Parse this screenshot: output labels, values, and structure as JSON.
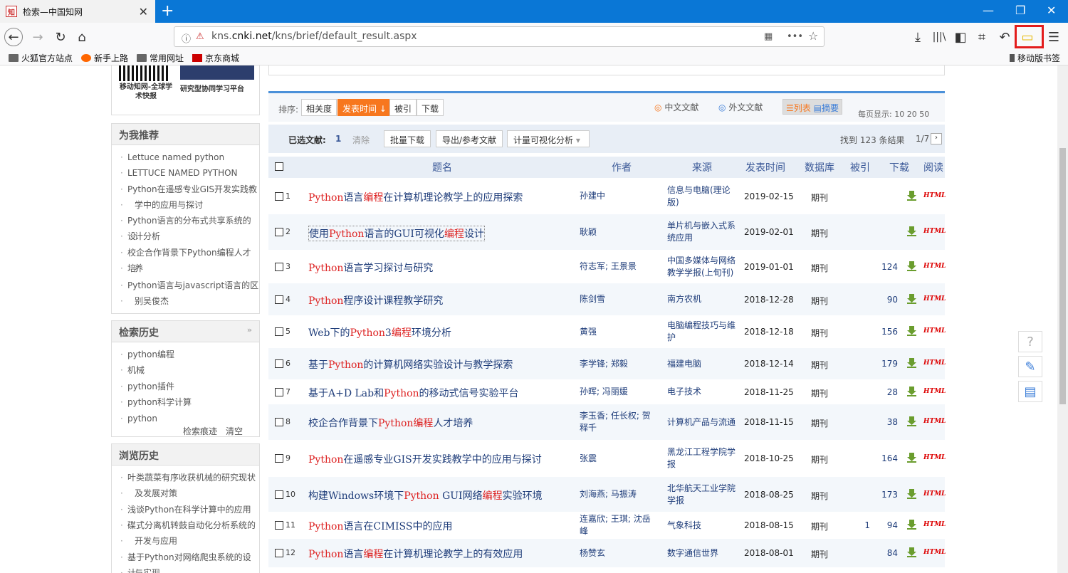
{
  "browser": {
    "tab_title": "检索—中国知网",
    "favicon_label": "知",
    "url_prefix": "kns.",
    "url_domain": "cnki.net",
    "url_path": "/kns/brief/default_result.aspx",
    "bookmarks": [
      "火狐官方站点",
      "新手上路",
      "常用网址",
      "京东商城"
    ],
    "mobile_bookmarks": "移动版书签"
  },
  "sidebar": {
    "qr_label": "移动知网-全球学术快报",
    "banner_label": "研究型协同学习平台",
    "recommend_title": "为我推荐",
    "recommend": [
      "Lettuce named python",
      "LETTUCE NAMED PYTHON",
      "Python在遥感专业GIS开发实践教",
      "学中的应用与探讨",
      "Python语言的分布式共享系统的设",
      "计分析",
      "校企合作背景下Python编程人才培",
      "养",
      "Python语言与javascript语言的区",
      "别吴俊杰"
    ],
    "history_title": "检索历史",
    "history": [
      "python编程",
      "机械",
      "python插件",
      "python科学计算",
      "python"
    ],
    "history_trace": "检索痕迹",
    "history_clear": "清空",
    "browse_title": "浏览历史",
    "browse": [
      "叶类蔬菜有序收获机械的研究现状",
      "及发展对策",
      "浅谈Python在科学计算中的应用",
      "碟式分离机转鼓自动化分析系统的",
      "开发与应用",
      "基于Python对网络爬虫系统的设计",
      "与实现"
    ]
  },
  "toolbar": {
    "sort_label": "排序:",
    "sort_options": [
      "相关度",
      "发表时间",
      "被引",
      "下载"
    ],
    "chinese_docs": "中文文献",
    "foreign_docs": "外文文献",
    "view_list": "列表",
    "view_abstract": "摘要",
    "per_page": "每页显示: 10 20 50",
    "selected_label": "已选文献:",
    "selected_count": "1",
    "clear": "清除",
    "batch_download": "批量下载",
    "export": "导出/参考文献",
    "visualize": "计量可视化分析",
    "result_count": "找到 123 条结果",
    "page_info": "1/7"
  },
  "table": {
    "headers": [
      "题名",
      "作者",
      "来源",
      "发表时间",
      "数据库",
      "被引",
      "下载",
      "阅读"
    ],
    "rows": [
      {
        "n": "1",
        "title": "Python语言编程在计算机理论教学上的应用探索",
        "author": "孙建中",
        "source": "信息与电脑(理论版)",
        "date": "2019-02-15",
        "db": "期刊",
        "cite": "",
        "dl": ""
      },
      {
        "n": "2",
        "title": "使用Python语言的GUI可视化编程设计",
        "author": "耿颖",
        "source": "单片机与嵌入式系统应用",
        "date": "2019-02-01",
        "db": "期刊",
        "cite": "",
        "dl": ""
      },
      {
        "n": "3",
        "title": "Python语言学习探讨与研究",
        "author": "符志军; 王景景",
        "source": "中国多媒体与网络教学学报(上旬刊)",
        "date": "2019-01-01",
        "db": "期刊",
        "cite": "",
        "dl": "124"
      },
      {
        "n": "4",
        "title": "Python程序设计课程教学研究",
        "author": "陈剑雪",
        "source": "南方农机",
        "date": "2018-12-28",
        "db": "期刊",
        "cite": "",
        "dl": "90"
      },
      {
        "n": "5",
        "title": "Web下的Python3编程环境分析",
        "author": "黄强",
        "source": "电脑编程技巧与维护",
        "date": "2018-12-18",
        "db": "期刊",
        "cite": "",
        "dl": "156"
      },
      {
        "n": "6",
        "title": "基于Python的计算机网络实验设计与教学探索",
        "author": "李学锋; 郑毅",
        "source": "福建电脑",
        "date": "2018-12-14",
        "db": "期刊",
        "cite": "",
        "dl": "179"
      },
      {
        "n": "7",
        "title": "基于A+D Lab和Python的移动式信号实验平台",
        "author": "孙晖; 冯丽媛",
        "source": "电子技术",
        "date": "2018-11-25",
        "db": "期刊",
        "cite": "",
        "dl": "28"
      },
      {
        "n": "8",
        "title": "校企合作背景下Python编程人才培养",
        "author": "李玉香; 任长权; 贺释千",
        "source": "计算机产品与流通",
        "date": "2018-11-15",
        "db": "期刊",
        "cite": "",
        "dl": "38"
      },
      {
        "n": "9",
        "title": "Python在遥感专业GIS开发实践教学中的应用与探讨",
        "author": "张震",
        "source": "黑龙江工程学院学报",
        "date": "2018-10-25",
        "db": "期刊",
        "cite": "",
        "dl": "164"
      },
      {
        "n": "10",
        "title": "构建Windows环境下Python GUI网络编程实验环境",
        "author": "刘海燕; 马振涛",
        "source": "北华航天工业学院学报",
        "date": "2018-08-25",
        "db": "期刊",
        "cite": "",
        "dl": "173"
      },
      {
        "n": "11",
        "title": "Python语言在CIMISS中的应用",
        "author": "连嘉欣; 王琪; 沈岳峰",
        "source": "气象科技",
        "date": "2018-08-15",
        "db": "期刊",
        "cite": "1",
        "dl": "94"
      },
      {
        "n": "12",
        "title": "Python语言编程在计算机理论教学上的有效应用",
        "author": "杨赞玄",
        "source": "数字通信世界",
        "date": "2018-08-01",
        "db": "期刊",
        "cite": "",
        "dl": "84"
      }
    ],
    "html_label": "HTML"
  },
  "colors": {
    "accent": "#f7771e",
    "link": "#1f3d7a",
    "title_bar": "#0a77d6",
    "highlight": "#e31c1c"
  }
}
